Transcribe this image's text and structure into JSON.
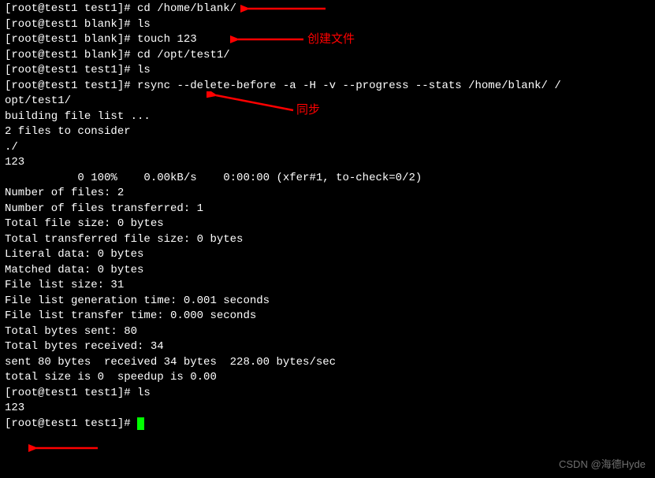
{
  "lines": {
    "l1_prompt": "[root@test1 test1]# ",
    "l1_cmd": "cd /home/blank/",
    "l2_prompt": "[root@test1 blank]# ",
    "l2_cmd": "ls",
    "l3_prompt": "[root@test1 blank]# ",
    "l3_cmd": "touch 123",
    "l4_prompt": "[root@test1 blank]# ",
    "l4_cmd": "cd /opt/test1/",
    "l5_prompt": "[root@test1 test1]# ",
    "l5_cmd": "ls",
    "l6_prompt": "[root@test1 test1]# ",
    "l6_cmd": "rsync --delete-before -a -H -v --progress --stats /home/blank/ /",
    "l7": "opt/test1/",
    "l8": "building file list ...",
    "l9": "2 files to consider",
    "l10": "./",
    "l11": "123",
    "l12": "           0 100%    0.00kB/s    0:00:00 (xfer#1, to-check=0/2)",
    "l13": "",
    "l14": "Number of files: 2",
    "l15": "Number of files transferred: 1",
    "l16": "Total file size: 0 bytes",
    "l17": "Total transferred file size: 0 bytes",
    "l18": "Literal data: 0 bytes",
    "l19": "Matched data: 0 bytes",
    "l20": "File list size: 31",
    "l21": "File list generation time: 0.001 seconds",
    "l22": "File list transfer time: 0.000 seconds",
    "l23": "Total bytes sent: 80",
    "l24": "Total bytes received: 34",
    "l25": "",
    "l26": "sent 80 bytes  received 34 bytes  228.00 bytes/sec",
    "l27": "total size is 0  speedup is 0.00",
    "l28_prompt": "[root@test1 test1]# ",
    "l28_cmd": "ls",
    "l29": "123",
    "l30_prompt": "[root@test1 test1]# "
  },
  "annotations": {
    "create_file": "创建文件",
    "sync": "同步"
  },
  "watermark": "CSDN @海德Hyde"
}
